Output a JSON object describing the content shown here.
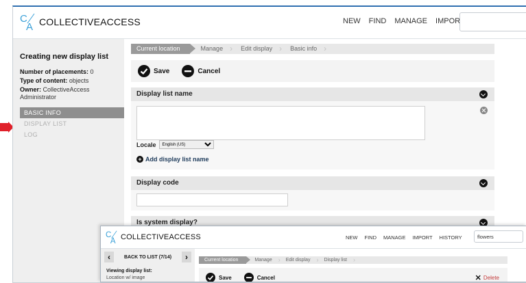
{
  "main": {
    "logo_text": "COLLECTIVEACCESS",
    "nav": [
      "NEW",
      "FIND",
      "MANAGE",
      "IMPORT"
    ],
    "sidebar": {
      "title": "Creating new display list",
      "placements_label": "Number of placements:",
      "placements_value": "0",
      "content_label": "Type of content:",
      "content_value": "objects",
      "owner_label": "Owner:",
      "owner_value": "CollectiveAccess Administrator",
      "items": [
        {
          "label": "BASIC INFO",
          "active": true
        },
        {
          "label": "DISPLAY LIST",
          "active": false
        },
        {
          "label": "LOG",
          "active": false
        }
      ]
    },
    "breadcrumbs": [
      "Current location",
      "Manage",
      "Edit display",
      "Basic info"
    ],
    "toolbar": {
      "save_label": "Save",
      "cancel_label": "Cancel"
    },
    "sections": {
      "name_header": "Display list name",
      "locale_label": "Locale",
      "locale_value": "English (US)",
      "add_name_label": "Add display list name",
      "code_header": "Display code",
      "system_header": "Is system display?"
    }
  },
  "second": {
    "logo_text": "COLLECTIVEACCESS",
    "nav": [
      "NEW",
      "FIND",
      "MANAGE",
      "IMPORT",
      "HISTORY"
    ],
    "search_value": "flowers",
    "back_label": "BACK TO LIST (7/14)",
    "sidebar_title": "Viewing display list:",
    "sidebar_subtitle": "Location w/ image",
    "breadcrumbs": [
      "Current location",
      "Manage",
      "Edit display",
      "Display list"
    ],
    "toolbar": {
      "save_label": "Save",
      "cancel_label": "Cancel",
      "delete_label": "Delete"
    }
  },
  "colors": {
    "accent": "#2f6fb0",
    "active_nav": "#8e8e8e",
    "delete": "#c43b3b",
    "arrow": "#e0202a"
  }
}
